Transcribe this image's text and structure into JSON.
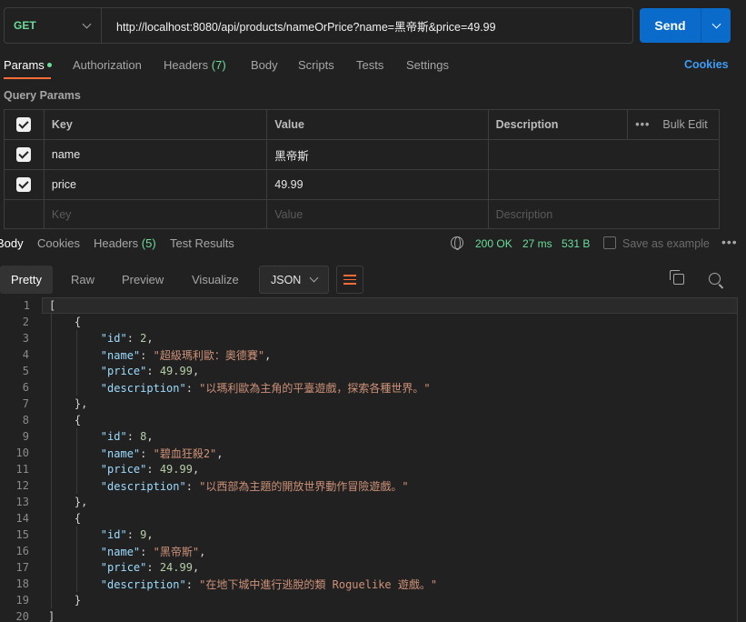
{
  "request": {
    "method": "GET",
    "url": "http://localhost:8080/api/products/nameOrPrice?name=黑帝斯&price=49.99",
    "send_label": "Send"
  },
  "req_tabs": {
    "params": "Params",
    "authorization": "Authorization",
    "headers": "Headers",
    "headers_count": "(7)",
    "body": "Body",
    "scripts": "Scripts",
    "tests": "Tests",
    "settings": "Settings",
    "cookies": "Cookies"
  },
  "query_params": {
    "title": "Query Params",
    "columns": {
      "key": "Key",
      "value": "Value",
      "description": "Description",
      "bulk_edit": "Bulk Edit"
    },
    "rows": [
      {
        "key": "name",
        "value": "黑帝斯",
        "description": ""
      },
      {
        "key": "price",
        "value": "49.99",
        "description": ""
      }
    ],
    "placeholders": {
      "key": "Key",
      "value": "Value",
      "description": "Description"
    }
  },
  "response": {
    "tabs": {
      "body": "Body",
      "cookies": "Cookies",
      "headers": "Headers",
      "headers_count": "(5)",
      "test_results": "Test Results"
    },
    "status": "200 OK",
    "time": "27 ms",
    "size": "531 B",
    "save_as_example": "Save as example",
    "views": {
      "pretty": "Pretty",
      "raw": "Raw",
      "preview": "Preview",
      "visualize": "Visualize"
    },
    "format": "JSON",
    "lines": [
      {
        "n": "1",
        "tokens": [
          {
            "t": "p",
            "v": "["
          }
        ]
      },
      {
        "n": "2",
        "tokens": [
          {
            "t": "p",
            "v": "    {"
          }
        ]
      },
      {
        "n": "3",
        "tokens": [
          {
            "t": "p",
            "v": "        "
          },
          {
            "t": "k",
            "v": "\"id\""
          },
          {
            "t": "p",
            "v": ": "
          },
          {
            "t": "n",
            "v": "2"
          },
          {
            "t": "p",
            "v": ","
          }
        ]
      },
      {
        "n": "4",
        "tokens": [
          {
            "t": "p",
            "v": "        "
          },
          {
            "t": "k",
            "v": "\"name\""
          },
          {
            "t": "p",
            "v": ": "
          },
          {
            "t": "s",
            "v": "\"超級瑪利歐：奧德賽\""
          },
          {
            "t": "p",
            "v": ","
          }
        ]
      },
      {
        "n": "5",
        "tokens": [
          {
            "t": "p",
            "v": "        "
          },
          {
            "t": "k",
            "v": "\"price\""
          },
          {
            "t": "p",
            "v": ": "
          },
          {
            "t": "n",
            "v": "49.99"
          },
          {
            "t": "p",
            "v": ","
          }
        ]
      },
      {
        "n": "6",
        "tokens": [
          {
            "t": "p",
            "v": "        "
          },
          {
            "t": "k",
            "v": "\"description\""
          },
          {
            "t": "p",
            "v": ": "
          },
          {
            "t": "s",
            "v": "\"以瑪利歐為主角的平臺遊戲，探索各種世界。\""
          }
        ]
      },
      {
        "n": "7",
        "tokens": [
          {
            "t": "p",
            "v": "    },"
          }
        ]
      },
      {
        "n": "8",
        "tokens": [
          {
            "t": "p",
            "v": "    {"
          }
        ]
      },
      {
        "n": "9",
        "tokens": [
          {
            "t": "p",
            "v": "        "
          },
          {
            "t": "k",
            "v": "\"id\""
          },
          {
            "t": "p",
            "v": ": "
          },
          {
            "t": "n",
            "v": "8"
          },
          {
            "t": "p",
            "v": ","
          }
        ]
      },
      {
        "n": "10",
        "tokens": [
          {
            "t": "p",
            "v": "        "
          },
          {
            "t": "k",
            "v": "\"name\""
          },
          {
            "t": "p",
            "v": ": "
          },
          {
            "t": "s",
            "v": "\"碧血狂殺2\""
          },
          {
            "t": "p",
            "v": ","
          }
        ]
      },
      {
        "n": "11",
        "tokens": [
          {
            "t": "p",
            "v": "        "
          },
          {
            "t": "k",
            "v": "\"price\""
          },
          {
            "t": "p",
            "v": ": "
          },
          {
            "t": "n",
            "v": "49.99"
          },
          {
            "t": "p",
            "v": ","
          }
        ]
      },
      {
        "n": "12",
        "tokens": [
          {
            "t": "p",
            "v": "        "
          },
          {
            "t": "k",
            "v": "\"description\""
          },
          {
            "t": "p",
            "v": ": "
          },
          {
            "t": "s",
            "v": "\"以西部為主題的開放世界動作冒險遊戲。\""
          }
        ]
      },
      {
        "n": "13",
        "tokens": [
          {
            "t": "p",
            "v": "    },"
          }
        ]
      },
      {
        "n": "14",
        "tokens": [
          {
            "t": "p",
            "v": "    {"
          }
        ]
      },
      {
        "n": "15",
        "tokens": [
          {
            "t": "p",
            "v": "        "
          },
          {
            "t": "k",
            "v": "\"id\""
          },
          {
            "t": "p",
            "v": ": "
          },
          {
            "t": "n",
            "v": "9"
          },
          {
            "t": "p",
            "v": ","
          }
        ]
      },
      {
        "n": "16",
        "tokens": [
          {
            "t": "p",
            "v": "        "
          },
          {
            "t": "k",
            "v": "\"name\""
          },
          {
            "t": "p",
            "v": ": "
          },
          {
            "t": "s",
            "v": "\"黑帝斯\""
          },
          {
            "t": "p",
            "v": ","
          }
        ]
      },
      {
        "n": "17",
        "tokens": [
          {
            "t": "p",
            "v": "        "
          },
          {
            "t": "k",
            "v": "\"price\""
          },
          {
            "t": "p",
            "v": ": "
          },
          {
            "t": "n",
            "v": "24.99"
          },
          {
            "t": "p",
            "v": ","
          }
        ]
      },
      {
        "n": "18",
        "tokens": [
          {
            "t": "p",
            "v": "        "
          },
          {
            "t": "k",
            "v": "\"description\""
          },
          {
            "t": "p",
            "v": ": "
          },
          {
            "t": "s",
            "v": "\"在地下城中進行逃脫的類 Roguelike 遊戲。\""
          }
        ]
      },
      {
        "n": "19",
        "tokens": [
          {
            "t": "p",
            "v": "    }"
          }
        ]
      },
      {
        "n": "20",
        "tokens": [
          {
            "t": "p",
            "v": "]"
          }
        ]
      }
    ]
  },
  "colors": {
    "accent": "#ff6c37",
    "send": "#0b6bcb",
    "success": "#6bdd9a",
    "link": "#3d9cf5"
  }
}
